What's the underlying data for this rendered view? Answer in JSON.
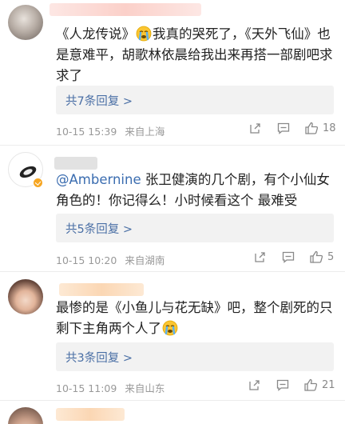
{
  "comments": [
    {
      "text_parts": [
        "《人龙传说》",
        "我真的哭死了，《天外飞仙》也是意难平，胡歌林依晨给我出来再搭一部剧吧求求了"
      ],
      "replies_label": "共7条回复 >",
      "date": "10-15 15:39",
      "location": "来自上海",
      "likes": "18"
    },
    {
      "mention": "@Ambernine",
      "text": " 张卫健演的几个剧，有个小仙女角色的！你记得么！小时候看这个 最难受",
      "replies_label": "共5条回复 >",
      "date": "10-15 10:20",
      "location": "来自湖南",
      "likes": "5"
    },
    {
      "text": "最惨的是《小鱼儿与花无缺》吧，整个剧死的只剩下主角两个人了",
      "replies_label": "共3条回复 >",
      "date": "10-15 11:09",
      "location": "来自山东",
      "likes": "21"
    }
  ],
  "colors": {
    "link": "#4a6fa5",
    "mention": "#3b6db0",
    "meta": "#999999",
    "reply_bg": "#f2f2f2",
    "vip_badge": "#f6a623"
  },
  "icons": [
    "share-icon",
    "comment-icon",
    "like-icon",
    "crying-emoji-icon"
  ]
}
